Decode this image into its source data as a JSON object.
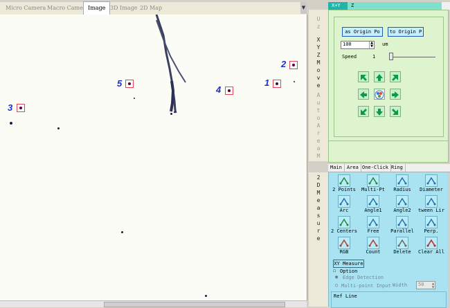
{
  "image_tabs": [
    "Micro Camera",
    "Macro Camera",
    "Image",
    "3D Image",
    "2D Map"
  ],
  "image_active_tab": "Image",
  "markers": [
    {
      "label": "1"
    },
    {
      "label": "2"
    },
    {
      "label": "3"
    },
    {
      "label": "4"
    },
    {
      "label": "5"
    }
  ],
  "vertical_labels": {
    "top": "Uz",
    "xyz_move": "XYZMove",
    "auto_area": "AutoArea",
    "m": "M",
    "measure": "2DMeasure"
  },
  "xyz": {
    "tabs": [
      "X+Y",
      "Z"
    ],
    "as_origin_label": "as Origin Po",
    "to_origin_label": "to Origin P",
    "step_value": "100",
    "step_unit": "um",
    "speed_label": "Speed",
    "speed_value": "1"
  },
  "measure": {
    "tabs": [
      "Main",
      "Area",
      "One-Click",
      "Ring"
    ],
    "tools": [
      {
        "label": "2 Points",
        "icon": "line-icon"
      },
      {
        "label": "Multi-Pt",
        "icon": "multi-point-icon"
      },
      {
        "label": "Radius",
        "icon": "radius-icon"
      },
      {
        "label": "Diameter",
        "icon": "diameter-icon"
      },
      {
        "label": "Arc",
        "icon": "arc-icon"
      },
      {
        "label": "Angle1",
        "icon": "angle-icon"
      },
      {
        "label": "Angle2",
        "icon": "angle-icon"
      },
      {
        "label": "tween Lir",
        "icon": "parallel-lines-icon"
      },
      {
        "label": "2 Centers",
        "icon": "centers-icon"
      },
      {
        "label": "Free",
        "icon": "free-icon"
      },
      {
        "label": "Parallel",
        "icon": "parallel-icon"
      },
      {
        "label": "Perp.",
        "icon": "perpendicular-icon"
      },
      {
        "label": "RGB",
        "icon": "rgb-icon"
      },
      {
        "label": "Count",
        "icon": "count-icon"
      },
      {
        "label": "Delete",
        "icon": "trash-icon"
      },
      {
        "label": "Clear All",
        "icon": "clear-icon"
      }
    ],
    "xy_measure_label": "XY Measure",
    "option_label": "Option",
    "edge_detection_label": "Edge Detection",
    "multipoint_label": "Multi-point Input",
    "width_label": "Width",
    "width_value": "50",
    "ref_line_label": "Ref Line"
  },
  "colors": {
    "xyz_panel_bg": "#ddf4cf",
    "measure_panel_bg": "#a9e3f2",
    "tab_active_bg": "#5ad0b9",
    "marker_border": "#e0455a",
    "marker_label": "#1e2fd0"
  }
}
